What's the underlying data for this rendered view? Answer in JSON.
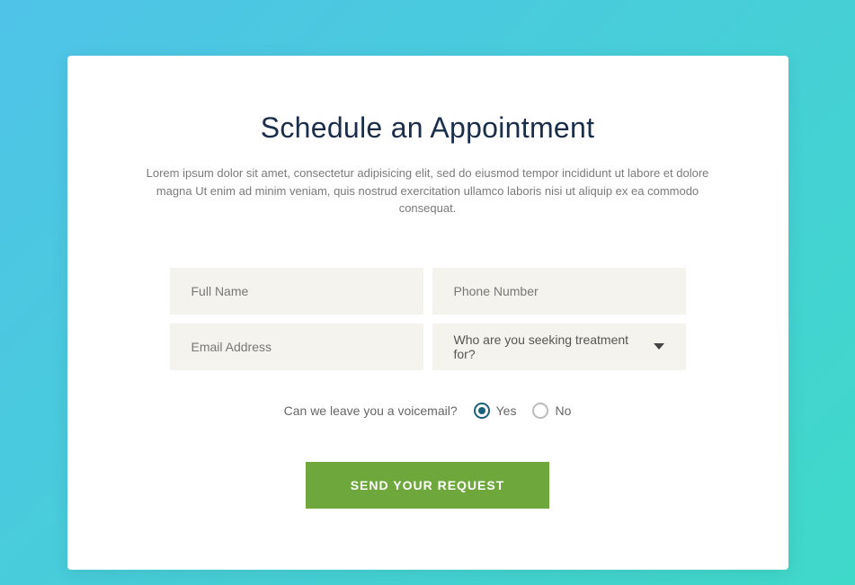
{
  "header": {
    "title": "Schedule an Appointment",
    "description": "Lorem ipsum dolor sit amet, consectetur adipisicing elit, sed do eiusmod tempor incididunt ut labore et dolore magna Ut enim ad minim veniam, quis nostrud exercitation ullamco laboris nisi ut aliquip ex ea commodo consequat."
  },
  "form": {
    "fullName": {
      "placeholder": "Full Name"
    },
    "phone": {
      "placeholder": "Phone Number"
    },
    "email": {
      "placeholder": "Email Address"
    },
    "treatment": {
      "label": "Who are you seeking treatment for?"
    },
    "voicemail": {
      "question": "Can we leave you a voicemail?",
      "options": {
        "yes": "Yes",
        "no": "No"
      },
      "selected": "yes"
    },
    "submit": {
      "label": "SEND YOUR REQUEST"
    }
  }
}
